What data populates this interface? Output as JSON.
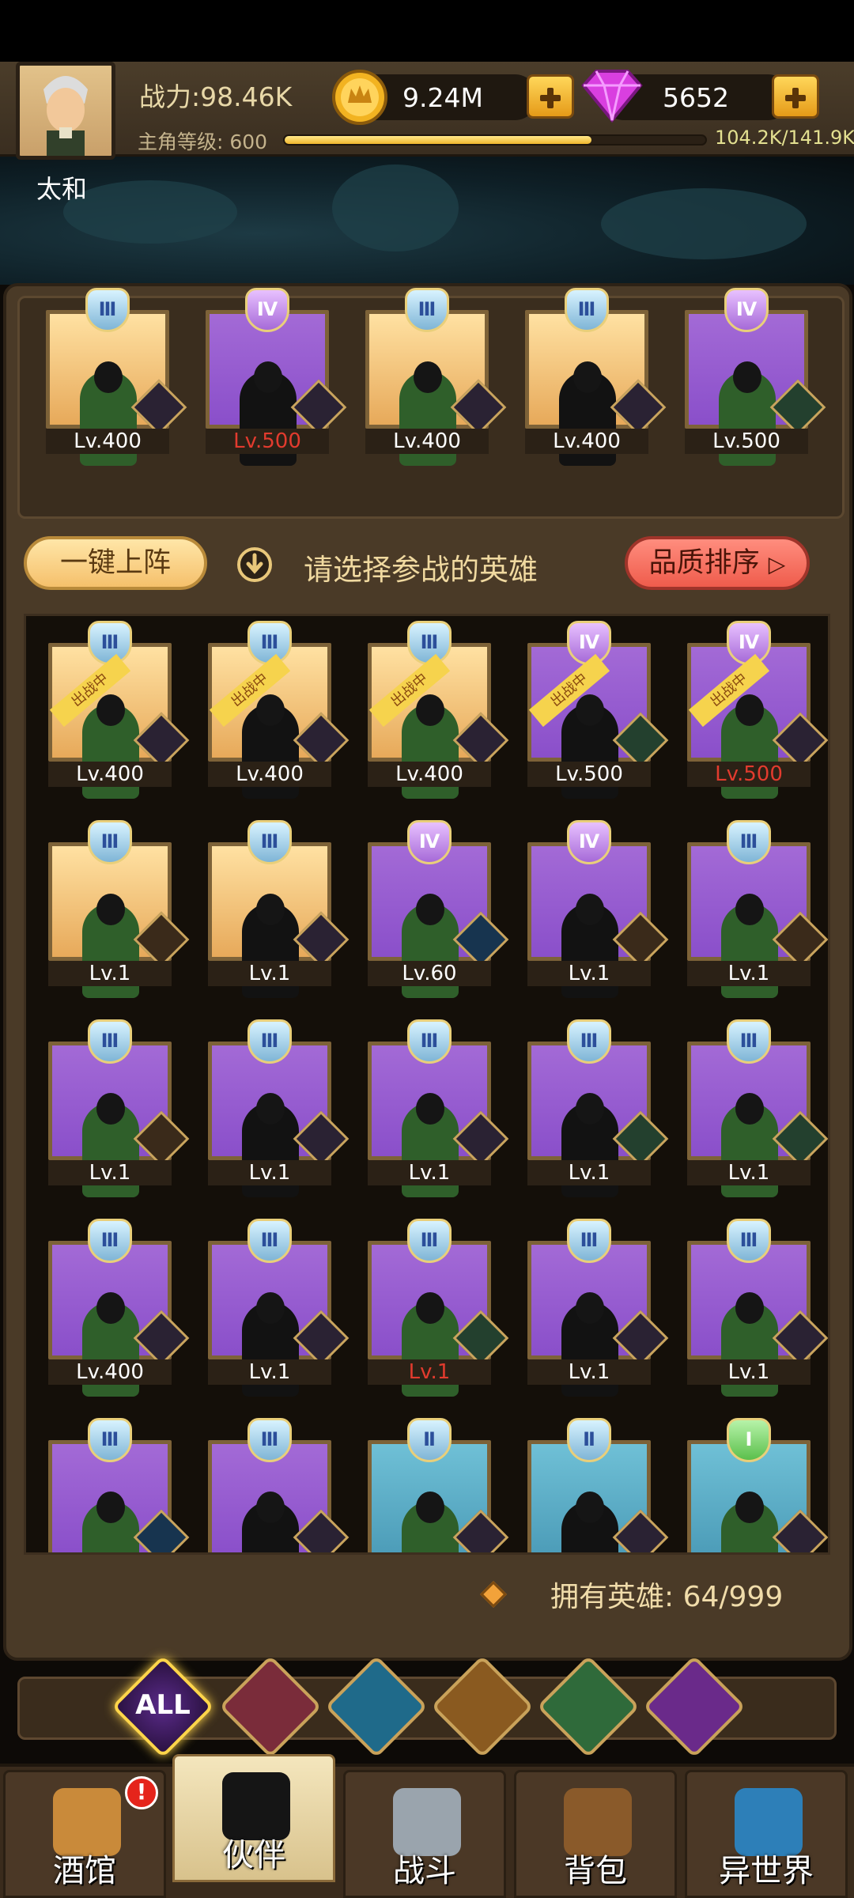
{
  "player": {
    "name": "太和",
    "power": "战力:98.46K",
    "level_label": "主角等级: 600",
    "xp_text": "104.2K/141.9K",
    "xp_progress": 0.73
  },
  "currency": {
    "gold": "9.24M",
    "gems": "5652"
  },
  "lineup": [
    {
      "tier": "Ⅲ",
      "level": "Lv.400",
      "bg": "gold",
      "faction": "demon-icon",
      "level_red": false
    },
    {
      "tier": "Ⅳ",
      "level": "Lv.500",
      "bg": "purple",
      "faction": "knight-icon",
      "level_red": true
    },
    {
      "tier": "Ⅲ",
      "level": "Lv.400",
      "bg": "gold",
      "faction": "demon-icon",
      "level_red": false
    },
    {
      "tier": "Ⅲ",
      "level": "Lv.400",
      "bg": "gold",
      "faction": "knight-icon",
      "level_red": false
    },
    {
      "tier": "Ⅳ",
      "level": "Lv.500",
      "bg": "purple",
      "faction": "elf-icon",
      "level_red": false
    }
  ],
  "controls": {
    "auto_deploy": "一键上阵",
    "hint": "请选择参战的英雄",
    "sort": "品质排序",
    "deployed_tag": "出战中"
  },
  "heroes": [
    {
      "tier": "Ⅲ",
      "level": "Lv.400",
      "bg": "gold",
      "faction": "demon-icon",
      "deployed": true
    },
    {
      "tier": "Ⅲ",
      "level": "Lv.400",
      "bg": "gold",
      "faction": "demon-icon",
      "deployed": true
    },
    {
      "tier": "Ⅲ",
      "level": "Lv.400",
      "bg": "gold",
      "faction": "knight-icon",
      "deployed": true
    },
    {
      "tier": "Ⅳ",
      "level": "Lv.500",
      "bg": "purple",
      "faction": "elf-icon",
      "deployed": true
    },
    {
      "tier": "Ⅳ",
      "level": "Lv.500",
      "bg": "purple",
      "faction": "knight-icon",
      "deployed": true,
      "level_red": true
    },
    {
      "tier": "Ⅲ",
      "level": "Lv.1",
      "bg": "gold",
      "faction": "lion-icon"
    },
    {
      "tier": "Ⅲ",
      "level": "Lv.1",
      "bg": "gold",
      "faction": "knight-icon"
    },
    {
      "tier": "Ⅳ",
      "level": "Lv.60",
      "bg": "purple",
      "faction": "sea-icon"
    },
    {
      "tier": "Ⅳ",
      "level": "Lv.1",
      "bg": "purple",
      "faction": "lion-icon"
    },
    {
      "tier": "Ⅲ",
      "level": "Lv.1",
      "bg": "purple",
      "faction": "lion-icon"
    },
    {
      "tier": "Ⅲ",
      "level": "Lv.1",
      "bg": "purple",
      "faction": "lion-icon"
    },
    {
      "tier": "Ⅲ",
      "level": "Lv.1",
      "bg": "purple",
      "faction": "demon-icon"
    },
    {
      "tier": "Ⅲ",
      "level": "Lv.1",
      "bg": "purple",
      "faction": "demon-icon"
    },
    {
      "tier": "Ⅲ",
      "level": "Lv.1",
      "bg": "purple",
      "faction": "elf-icon"
    },
    {
      "tier": "Ⅲ",
      "level": "Lv.1",
      "bg": "purple",
      "faction": "elf-icon"
    },
    {
      "tier": "Ⅲ",
      "level": "Lv.400",
      "bg": "purple",
      "faction": "demon-icon"
    },
    {
      "tier": "Ⅲ",
      "level": "Lv.1",
      "bg": "purple",
      "faction": "demon-icon"
    },
    {
      "tier": "Ⅲ",
      "level": "Lv.1",
      "bg": "purple",
      "faction": "elf-icon",
      "level_red": true
    },
    {
      "tier": "Ⅲ",
      "level": "Lv.1",
      "bg": "purple",
      "faction": "knight-icon"
    },
    {
      "tier": "Ⅲ",
      "level": "Lv.1",
      "bg": "purple",
      "faction": "knight-icon"
    },
    {
      "tier": "Ⅲ",
      "level": "",
      "bg": "purple",
      "faction": "sea-icon"
    },
    {
      "tier": "Ⅲ",
      "level": "",
      "bg": "purple",
      "faction": "knight-icon"
    },
    {
      "tier": "Ⅱ",
      "level": "",
      "bg": "blue",
      "faction": "knight-icon"
    },
    {
      "tier": "Ⅱ",
      "level": "",
      "bg": "blue",
      "faction": "knight-icon"
    },
    {
      "tier": "Ⅰ",
      "level": "",
      "bg": "blue",
      "faction": "knight-icon"
    }
  ],
  "owned_heroes": "拥有英雄: 64/999",
  "filters": [
    {
      "label": "ALL",
      "icon": "all-icon"
    },
    {
      "label": "",
      "icon": "knight-faction-icon"
    },
    {
      "label": "",
      "icon": "sea-faction-icon"
    },
    {
      "label": "",
      "icon": "lion-faction-icon"
    },
    {
      "label": "",
      "icon": "elf-faction-icon"
    },
    {
      "label": "",
      "icon": "demon-faction-icon"
    }
  ],
  "nav": [
    {
      "label": "酒馆",
      "icon": "beer-mug-icon"
    },
    {
      "label": "伙伴",
      "icon": "partner-icon"
    },
    {
      "label": "战斗",
      "icon": "crossed-swords-icon"
    },
    {
      "label": "背包",
      "icon": "backpack-icon"
    },
    {
      "label": "异世界",
      "icon": "portal-icon"
    }
  ],
  "nav_alert": "!",
  "colors": {
    "accent_gold": "#f0b72d",
    "gem": "#d93fe0",
    "panel": "#4a3a27",
    "sort_button": "#ef5c4c"
  }
}
